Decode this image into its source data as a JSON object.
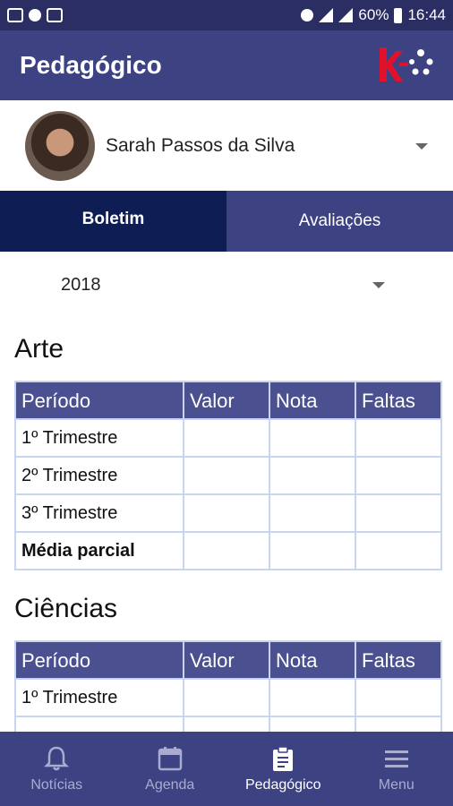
{
  "status_bar": {
    "battery": "60%",
    "time": "16:44"
  },
  "app_bar": {
    "title": "Pedagógico"
  },
  "profile": {
    "name": "Sarah Passos da Silva"
  },
  "tabs": [
    {
      "label": "Boletim",
      "active": true
    },
    {
      "label": "Avaliações",
      "active": false
    }
  ],
  "year_select": {
    "value": "2018"
  },
  "table_headers": {
    "periodo": "Período",
    "valor": "Valor",
    "nota": "Nota",
    "faltas": "Faltas"
  },
  "subjects": [
    {
      "title": "Arte",
      "rows": [
        {
          "periodo": "1º Trimestre",
          "valor": "",
          "nota": "",
          "faltas": ""
        },
        {
          "periodo": "2º Trimestre",
          "valor": "",
          "nota": "",
          "faltas": ""
        },
        {
          "periodo": "3º Trimestre",
          "valor": "",
          "nota": "",
          "faltas": ""
        },
        {
          "periodo": "Média parcial",
          "valor": "",
          "nota": "",
          "faltas": ""
        }
      ]
    },
    {
      "title": "Ciências",
      "rows": [
        {
          "periodo": "1º Trimestre",
          "valor": "",
          "nota": "",
          "faltas": ""
        }
      ]
    }
  ],
  "bottom_nav": [
    {
      "label": "Notícias",
      "icon": "bell-icon",
      "active": false
    },
    {
      "label": "Agenda",
      "icon": "calendar-icon",
      "active": false
    },
    {
      "label": "Pedagógico",
      "icon": "clipboard-icon",
      "active": true
    },
    {
      "label": "Menu",
      "icon": "menu-icon",
      "active": false
    }
  ],
  "colors": {
    "primary": "#3d4283",
    "active_tab": "#0f1d55",
    "table_header": "#4a5090",
    "logo": "#e0122b"
  }
}
